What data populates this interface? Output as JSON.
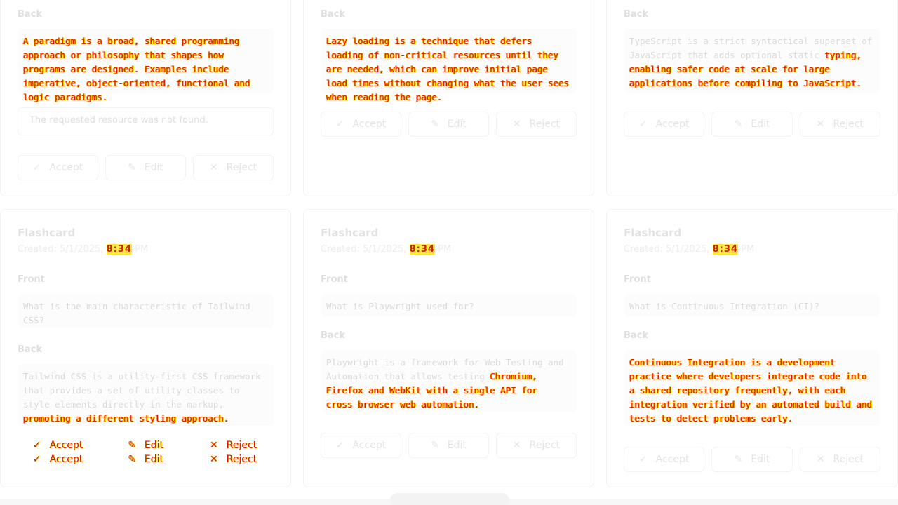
{
  "cards_top": [
    {
      "back_label": "Back",
      "back_text": "A paradigm is a broad, shared programming approach or philosophy that shapes how programs are designed. Examples include imperative, object-oriented, functional and logic paradigms.",
      "message": "The requested resource was not found.",
      "actions": {
        "accept": "Accept",
        "edit": "Edit",
        "reject": "Reject"
      }
    },
    {
      "back_label": "Back",
      "back_text": "Lazy loading is a technique that defers loading of non-critical resources until they are needed, which can improve initial page load times without changing what the user sees when reading the page.",
      "actions": {
        "accept": "Accept",
        "edit": "Edit",
        "reject": "Reject"
      }
    },
    {
      "back_label": "Back",
      "back_text_plain": "TypeScript is a strict syntactical superset of JavaScript that adds optional static",
      "back_text_glitch": "typing, enabling safer code at scale for large applications before compiling to JavaScript.",
      "actions": {
        "accept": "Accept",
        "edit": "Edit",
        "reject": "Reject"
      }
    }
  ],
  "cards_bottom": [
    {
      "title": "Flashcard",
      "created_prefix": "Created: 5/1/2025, ",
      "created_time": "8:34",
      "created_suffix": " PM",
      "front_label": "Front",
      "front_text": "What is the main characteristic of Tailwind CSS?",
      "back_label": "Back",
      "back_text_plain": "Tailwind CSS is a utility-first CSS framework that provides a set of utility classes to style elements directly in the markup,",
      "back_text_glitch": "promoting a different styling approach.",
      "actions": {
        "accept": "Accept",
        "edit": "Edit",
        "reject": "Reject"
      }
    },
    {
      "title": "Flashcard",
      "created_prefix": "Created: 5/1/2025, ",
      "created_time": "8:34",
      "created_suffix": " PM",
      "front_label": "Front",
      "front_text": "What is Playwright used for?",
      "back_label": "Back",
      "back_text_plain": "Playwright is a framework for Web Testing and Automation that allows testing",
      "back_text_glitch": "Chromium, Firefox and WebKit with a single API for cross-browser web automation.",
      "actions": {
        "accept": "Accept",
        "edit": "Edit",
        "reject": "Reject"
      }
    },
    {
      "title": "Flashcard",
      "created_prefix": "Created: 5/1/2025, ",
      "created_time": "8:34",
      "created_suffix": " PM",
      "front_label": "Front",
      "front_text": "What is Continuous Integration (CI)?",
      "back_label": "Back",
      "back_text_glitch": "Continuous Integration is a development practice where developers integrate code into a shared repository frequently, with each integration verified by an automated build and tests to detect problems early.",
      "actions": {
        "accept": "Accept",
        "edit": "Edit",
        "reject": "Reject"
      }
    }
  ]
}
